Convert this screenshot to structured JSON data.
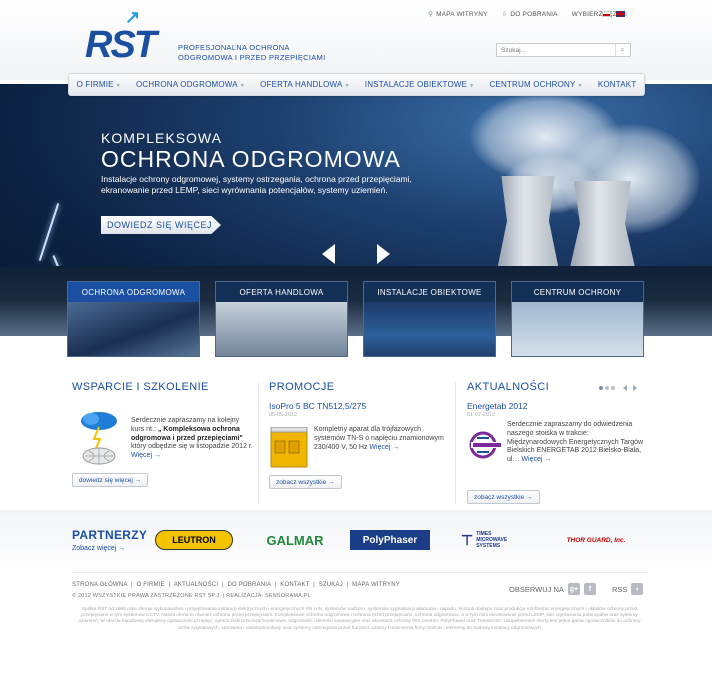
{
  "header": {
    "sitemap_label": "MAPA WITRYNY",
    "downloads_label": "DO POBRANIA",
    "language_label": "WYBIERZ JĘZYK:",
    "logo_text": "RST",
    "tagline_line1": "PROFESJONALNA OCHRONA",
    "tagline_line2": "ODGROMOWA I PRZED PRZEPIĘCIAMI",
    "search_placeholder": "Szukaj..."
  },
  "nav": {
    "items": [
      {
        "label": "O FIRMIE",
        "dropdown": true
      },
      {
        "label": "OCHRONA ODGROMOWA",
        "dropdown": true
      },
      {
        "label": "OFERTA HANDLOWA",
        "dropdown": true
      },
      {
        "label": "INSTALACJE OBIEKTOWE",
        "dropdown": true
      },
      {
        "label": "CENTRUM OCHRONY",
        "dropdown": true
      },
      {
        "label": "KONTAKT",
        "dropdown": false
      }
    ]
  },
  "hero": {
    "subtitle": "KOMPLEKSOWA",
    "title": "OCHRONA ODGROMOWA",
    "description": "Instalacje ochrony odgromowej, systemy ostrzegania, ochrona przed przepięciami, ekranowanie przed LEMP, sieci wyrównania potencjałów, systemy uziemień.",
    "button_label": "DOWIEDZ SIĘ WIĘCEJ"
  },
  "cards": [
    {
      "label": "OCHRONA ODGROMOWA"
    },
    {
      "label": "OFERTA HANDLOWA"
    },
    {
      "label": "INSTALACJE OBIEKTOWE"
    },
    {
      "label": "CENTRUM OCHRONY"
    }
  ],
  "support": {
    "heading": "WSPARCIE I SZKOLENIE",
    "text_before": "Serdecznie zapraszamy na kolejny kurs nt.: ",
    "text_bold": "„ Kompleksowa ochrona odgromowa i przed przepięciami\"",
    "text_after": " który odbędzie się w listopadzie 2012 r. ",
    "more": "Więcej →",
    "button": "dowiedz się więcej  →"
  },
  "promo": {
    "heading": "PROMOCJE",
    "title": "IsoPro 5 BC TN512,5/275",
    "date": "05-05-2012",
    "text": "Kompletny aparat dla trójfazowych systemów TN-S o napięciu znamionowym 230/400 V, 50 Hz ",
    "more": "Więcej →",
    "button": "zobacz wszystkie  →"
  },
  "news": {
    "heading": "AKTUALNOŚCI",
    "title": "Energetab 2012",
    "date": "01-07-2012",
    "text": "Serdecznie zapraszamy do odwiedzenia naszego stoiska w trakcie: Międzynarodowych Energetycznych Targów Bielskich ENERGETAB 2012 Bielsko-Biała, ul… ",
    "more": "Więcej →",
    "button": "zobacz wszystkie  →"
  },
  "partners": {
    "heading": "PARTNERZY",
    "link": "Zobacz więcej →",
    "logos": [
      "LEUTRON",
      "GALMAR",
      "PolyPhaser",
      "TIMES MICROWAVE SYSTEMS",
      "THOR GUARD, Inc."
    ]
  },
  "footer": {
    "links": [
      "STRONA GŁÓWNA",
      "O FIRMIE",
      "AKTUALNOŚCI",
      "DO POBRANIA",
      "KONTAKT",
      "SZUKAJ",
      "MAPA WITRYNY"
    ],
    "copyright": "© 2012 WSZYSTKIE PRAWA ZASTRZEŻONE RST SP.J. | REALIZACJA: SENSORAMA.PL",
    "follow_label": "OBSERWUJ NA",
    "rss_label": "RSS",
    "about_text": "Spółka RST od 1996 roku oferuje wykonawstwo i projektowanie instalacji elektrycznych i energetycznych SN i nN, systemów nadzoru, systemów sygnalizacji włamania i napadu, kontroli dostępu oraz produkcję rozdzielnic energetycznych i układów ochrony przed przepięciami w tym systemów CCTV. Nasza oferta to również ochrona przed przepięciami. Kompleksowe ochrona odgromowa i ochrona przed przepięciami, ochrona odgromowa, a w tym mini ekranowanie przed LEMP, sieć wyrównania potencjałów oraz systemy uziemień. W ofercie handlowej oferujemy ograniczniki przepięć, ograniczniki przeciwprzepięciowe, odgromniki, iskierniki separacyjne oraz akcesoria ochrony firm Leutron, PolyPhaser oraz Transtector. Uzupełnieniem oferty jest pełna gama ograniczników do ochrony torów sygnałowych, sterownia i radiokomunikacji oraz systemy ostrzegania przed burzami, uziomy i uziemienia firmy Galmar i elementy do budowy instalacji odgromowych"
  },
  "colors": {
    "brand_blue": "#1b4fa2",
    "accent_blue": "#2a9ee0"
  }
}
